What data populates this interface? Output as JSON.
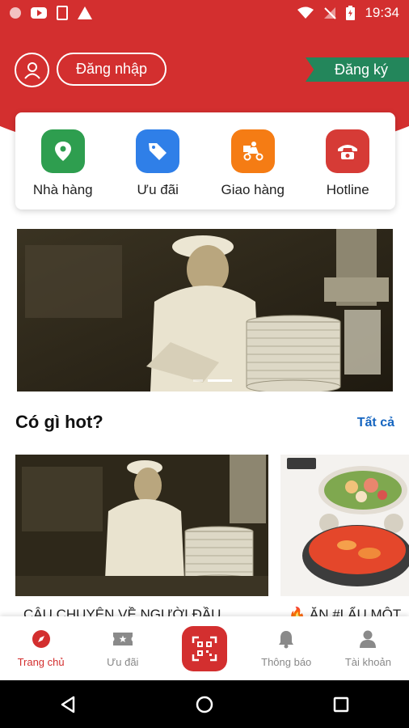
{
  "status_bar": {
    "time": "19:34"
  },
  "header": {
    "login_label": "Đăng nhập",
    "signup_label": "Đăng ký"
  },
  "quick_actions": [
    {
      "label": "Nhà hàng",
      "icon": "map-pin-icon",
      "color": "#2e9e4f"
    },
    {
      "label": "Ưu đãi",
      "icon": "tag-icon",
      "color": "#2f7fe8"
    },
    {
      "label": "Giao hàng",
      "icon": "delivery-scooter-icon",
      "color": "#f57c14"
    },
    {
      "label": "Hotline",
      "icon": "phone-icon",
      "color": "#d63b36"
    }
  ],
  "hot_section": {
    "title": "Có gì hot?",
    "see_all": "Tất cả",
    "cards": [
      {
        "title": "CÂU CHUYỆN VỀ NGƯỜI ĐẦU"
      },
      {
        "title": "🔥 ĂN #LẨU MỘT"
      }
    ]
  },
  "bottom_nav": [
    {
      "label": "Trang chủ",
      "icon": "compass-icon",
      "active": true
    },
    {
      "label": "Ưu đãi",
      "icon": "ticket-icon",
      "active": false
    },
    {
      "label": "",
      "icon": "qr-scan-icon",
      "active": false
    },
    {
      "label": "Thông báo",
      "icon": "bell-icon",
      "active": false
    },
    {
      "label": "Tài khoản",
      "icon": "person-icon",
      "active": false
    }
  ],
  "colors": {
    "brand_red": "#d32f2f",
    "signup_green": "#23865b",
    "link_blue": "#1565c0"
  }
}
